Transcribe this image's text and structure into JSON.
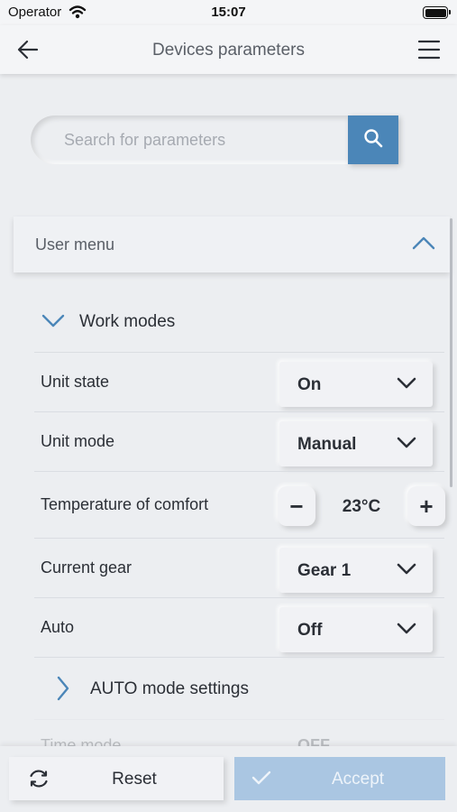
{
  "status_bar": {
    "carrier": "Operator",
    "time": "15:07"
  },
  "header": {
    "title": "Devices parameters"
  },
  "search": {
    "placeholder": "Search for parameters"
  },
  "section": {
    "label": "User menu"
  },
  "subsection": {
    "label": "Work modes"
  },
  "rows": {
    "unit_state": {
      "label": "Unit state",
      "value": "On"
    },
    "unit_mode": {
      "label": "Unit mode",
      "value": "Manual"
    },
    "temperature": {
      "label": "Temperature of comfort",
      "value": "23°C",
      "minus": "−",
      "plus": "+"
    },
    "current_gear": {
      "label": "Current gear",
      "value": "Gear 1"
    },
    "auto": {
      "label": "Auto",
      "value": "Off"
    }
  },
  "auto_settings": {
    "label": "AUTO mode settings"
  },
  "faded_row": {
    "label": "Time mode",
    "value": "OFF"
  },
  "footer": {
    "reset_label": "Reset",
    "accept_label": "Accept"
  },
  "colors": {
    "accent": "#4b86b8",
    "accept_disabled": "#aac6e2",
    "background": "#eceef1"
  },
  "icons": [
    "wifi-icon",
    "battery-icon",
    "back-arrow-icon",
    "hamburger-menu-icon",
    "search-icon",
    "chevron-up-icon",
    "chevron-down-icon",
    "chevron-right-icon",
    "refresh-icon",
    "checkmark-icon"
  ]
}
